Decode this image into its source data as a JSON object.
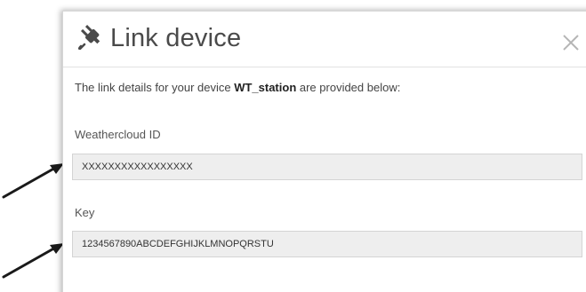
{
  "dialog": {
    "title": "Link device",
    "close_icon": "close-icon",
    "header_icon": "plug-icon"
  },
  "intro": {
    "prefix": "The link details for your device ",
    "device_name": "WT_station",
    "suffix": " are provided below:"
  },
  "fields": {
    "weathercloud_id": {
      "label": "Weathercloud ID",
      "value": "XXXXXXXXXXXXXXXXX"
    },
    "key": {
      "label": "Key",
      "value": "1234567890ABCDEFGHIJKLMNOPQRSTU"
    }
  },
  "colors": {
    "field_background": "#eeeeee",
    "arrow": "#1a1a1a",
    "title_text": "#4a4a4a"
  }
}
